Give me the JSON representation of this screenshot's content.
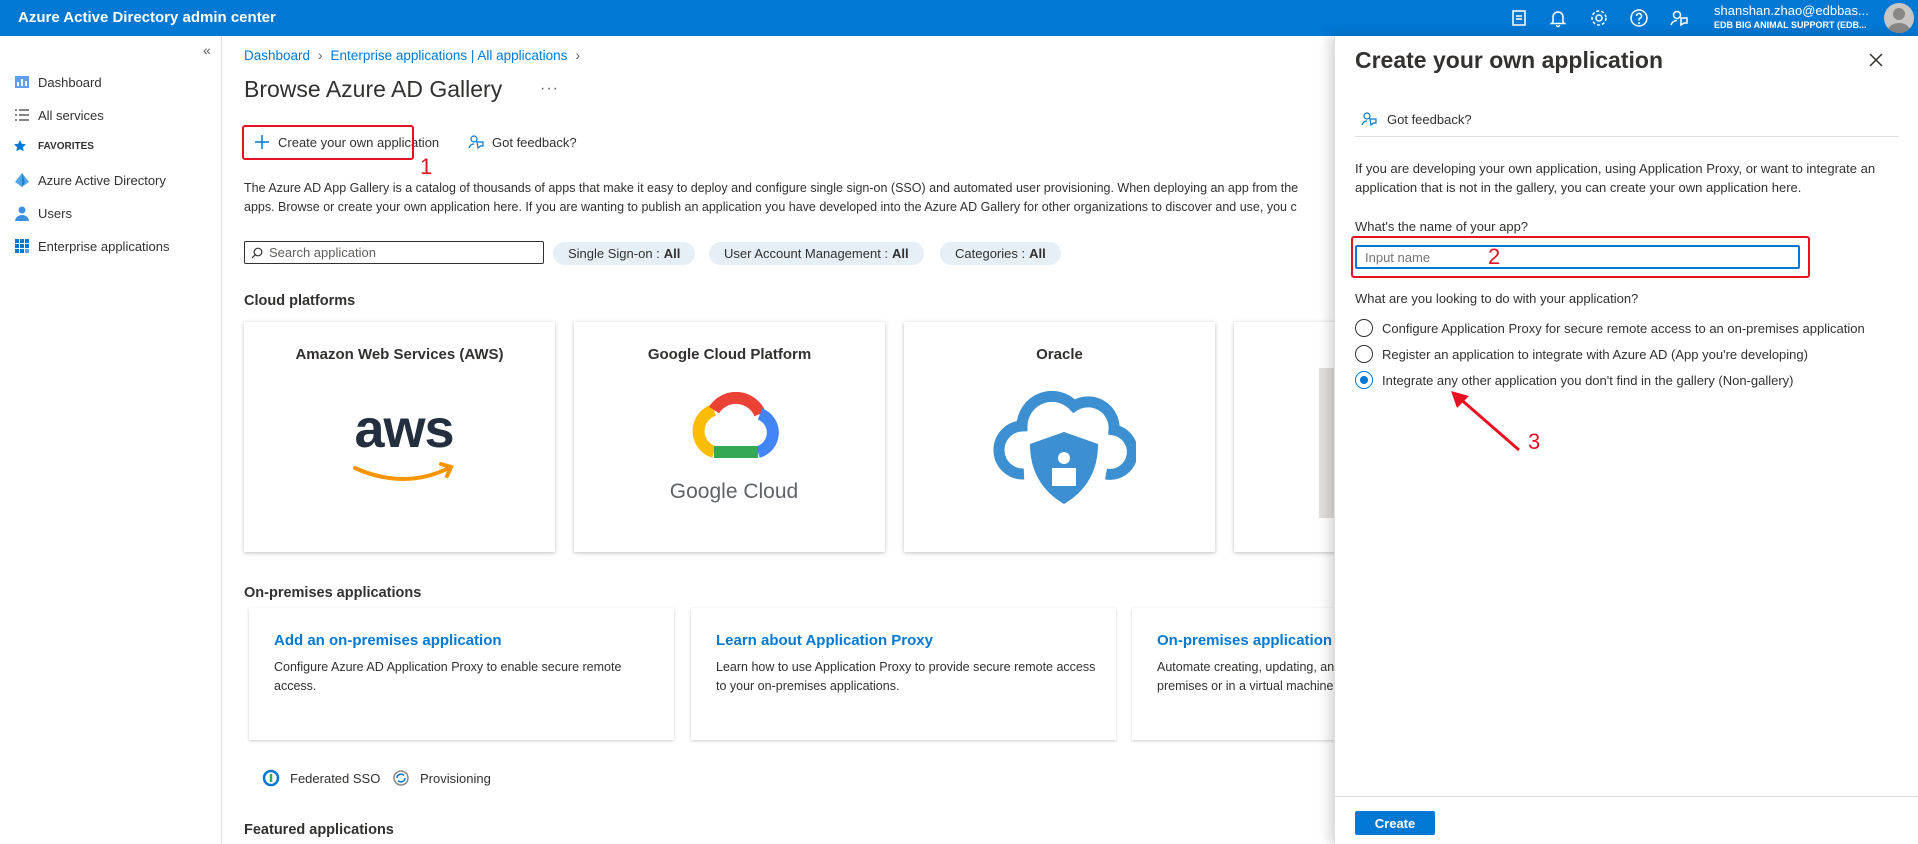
{
  "topbar": {
    "title": "Azure Active Directory admin center",
    "user_email": "shanshan.zhao@edbbas...",
    "user_org": "EDB BIG ANIMAL SUPPORT (EDB..."
  },
  "leftnav": {
    "collapse_glyph": "«",
    "items": [
      {
        "label": "Dashboard",
        "icon": "dashboard-icon"
      },
      {
        "label": "All services",
        "icon": "list-icon"
      }
    ],
    "favorites_label": "FAVORITES",
    "favorites": [
      {
        "label": "Azure Active Directory",
        "icon": "aad-icon"
      },
      {
        "label": "Users",
        "icon": "users-icon"
      },
      {
        "label": "Enterprise applications",
        "icon": "enterprise-apps-icon"
      }
    ]
  },
  "main": {
    "breadcrumb": [
      "Dashboard",
      "Enterprise applications | All applications"
    ],
    "title": "Browse Azure AD Gallery",
    "ellipsis": "···",
    "create_label": "Create your own application",
    "feedback_label": "Got feedback?",
    "description_line1": "The Azure AD App Gallery is a catalog of thousands of apps that make it easy to deploy and configure single sign-on (SSO) and automated user provisioning. When deploying an app from the",
    "description_line2": "apps. Browse or create your own application here. If you are wanting to publish an application you have developed into the Azure AD Gallery for other organizations to discover and use, you c",
    "search_placeholder": "Search application",
    "filters": [
      {
        "name": "Single Sign-on :",
        "value": "All"
      },
      {
        "name": "User Account Management :",
        "value": "All"
      },
      {
        "name": "Categories :",
        "value": "All"
      }
    ],
    "cloud_title": "Cloud platforms",
    "cloud_cards": [
      {
        "name": "Amazon Web Services (AWS)",
        "logo_text": "aws"
      },
      {
        "name": "Google Cloud Platform",
        "logo_text": "Google Cloud"
      },
      {
        "name": "Oracle",
        "logo_text": ""
      }
    ],
    "onprem_title": "On-premises applications",
    "onprem_cards": [
      {
        "title": "Add an on-premises application",
        "desc": "Configure Azure AD Application Proxy to enable secure remote access."
      },
      {
        "title": "Learn about Application Proxy",
        "desc": "Learn how to use Application Proxy to provide secure remote access to your on-premises applications."
      },
      {
        "title": "On-premises application",
        "desc": "Automate creating, updating, an premises or in a virtual machine."
      }
    ],
    "legend": [
      {
        "label": "Federated SSO",
        "icon": "federated-sso-icon"
      },
      {
        "label": "Provisioning",
        "icon": "provisioning-icon"
      }
    ],
    "featured_title": "Featured applications"
  },
  "panel": {
    "title": "Create your own application",
    "feedback_label": "Got feedback?",
    "description": "If you are developing your own application, using Application Proxy, or want to integrate an application that is not in the gallery, you can create your own application here.",
    "name_label": "What's the name of your app?",
    "name_placeholder": "Input name",
    "question": "What are you looking to do with your application?",
    "options": [
      {
        "label": "Configure Application Proxy for secure remote access to an on-premises application",
        "selected": false
      },
      {
        "label": "Register an application to integrate with Azure AD (App you're developing)",
        "selected": false
      },
      {
        "label": "Integrate any other application you don't find in the gallery (Non-gallery)",
        "selected": true
      }
    ],
    "create_label": "Create"
  },
  "annotations": {
    "one": "1",
    "two": "2",
    "three": "3"
  },
  "colors": {
    "accent": "#0078d4",
    "annotation": "#e81123"
  }
}
